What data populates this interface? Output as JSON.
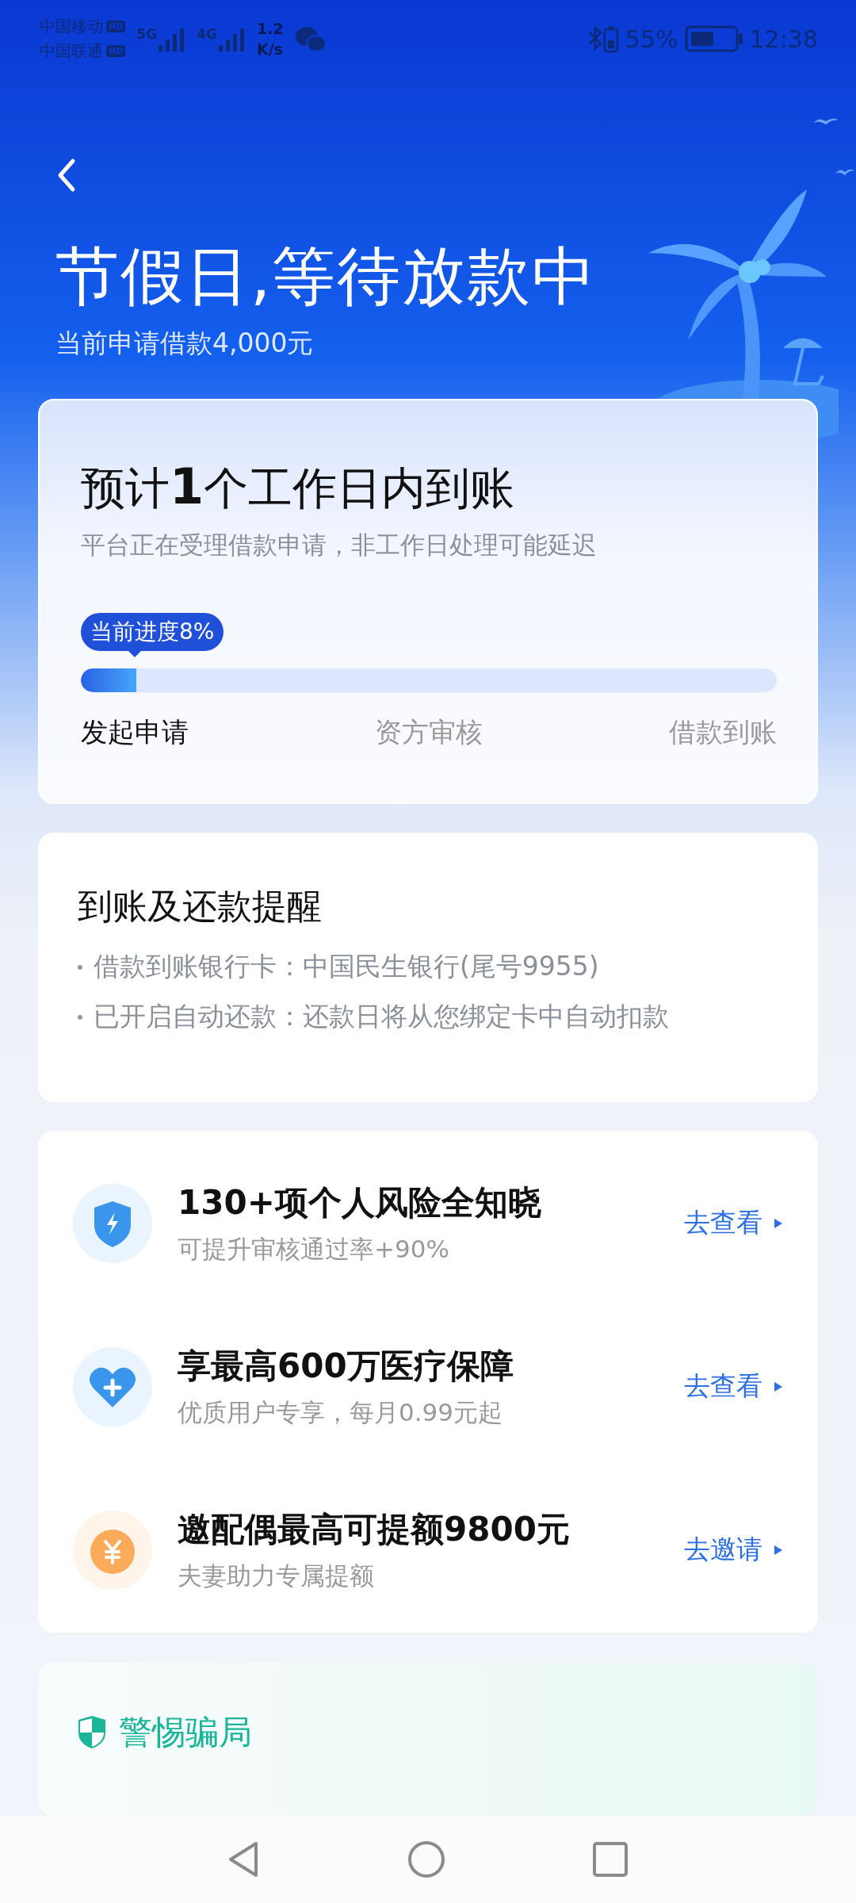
{
  "status_bar": {
    "carriers": [
      {
        "name": "中国移动",
        "badge": "HD"
      },
      {
        "name": "中国联通",
        "badge": "HD"
      }
    ],
    "network_1": "5G",
    "network_2": "4G",
    "speed_value": "1.2",
    "speed_unit": "K/s",
    "battery": "55%",
    "time": "12:38"
  },
  "header": {
    "title": "节假日,等待放款中",
    "subtitle": "当前申请借款4,000元"
  },
  "progress_card": {
    "title": "预计**1**个工作日内到账",
    "note": "平台正在受理借款申请，非工作日处理可能延迟",
    "badge": "当前进度8%",
    "level": 0.08,
    "steps": [
      {
        "label": "发起申请",
        "selected": true
      },
      {
        "label": "资方审核",
        "selected": false
      },
      {
        "label": "借款到账",
        "selected": false
      }
    ]
  },
  "reminder_card": {
    "title": "到账及还款提醒",
    "items": [
      "借款到账银行卡：中国民生银行(尾号9955)",
      "已开启自动还款：还款日将从您绑定卡中自动扣款"
    ]
  },
  "offers": [
    {
      "kind": "shield",
      "title": "130+项个人风险全知晓",
      "subtitle": "可提升审核通过率+90%",
      "action": "去查看"
    },
    {
      "kind": "heart",
      "title": "享最高600万医疗保障",
      "subtitle": "优质用户专享，每月0.99元起",
      "action": "去查看"
    },
    {
      "kind": "coin",
      "title": "邀配偶最高可提额9800元",
      "subtitle": "夫妻助力专属提额",
      "action": "去邀请"
    }
  ],
  "warning_card": {
    "title": "警惕骗局"
  }
}
